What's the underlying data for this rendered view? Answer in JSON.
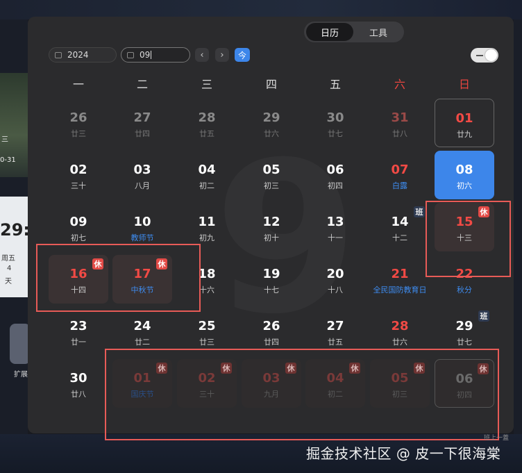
{
  "desktop": {
    "widget1": {
      "weekday_frag": "三",
      "range_frag": "0-31"
    },
    "widget2": {
      "time_frag": "29:",
      "weekday": "周五",
      "count": "4",
      "unit": "天"
    },
    "ext_label": "扩展"
  },
  "tabs": [
    {
      "label": "日历",
      "active": true
    },
    {
      "label": "工具",
      "active": false
    }
  ],
  "year_field": {
    "value": "2024"
  },
  "month_field": {
    "value": "09"
  },
  "nav": {
    "prev": "‹",
    "next": "›",
    "today": "今"
  },
  "toggle_on": true,
  "background_month": "9",
  "weekdays": [
    "一",
    "二",
    "三",
    "四",
    "五",
    "六",
    "日"
  ],
  "weekend_color": "#e9453f",
  "accent_color": "#3d86ea",
  "days": [
    {
      "day": "26",
      "lunar": "廿三",
      "style": "dim"
    },
    {
      "day": "27",
      "lunar": "廿四",
      "style": "dim"
    },
    {
      "day": "28",
      "lunar": "廿五",
      "style": "dim"
    },
    {
      "day": "29",
      "lunar": "廿六",
      "style": "dim"
    },
    {
      "day": "30",
      "lunar": "廿七",
      "style": "dim"
    },
    {
      "day": "31",
      "lunar": "廿八",
      "style": "dimred"
    },
    {
      "day": "01",
      "lunar": "廿九",
      "style": "red today-box"
    },
    {
      "day": "02",
      "lunar": "三十",
      "style": ""
    },
    {
      "day": "03",
      "lunar": "八月",
      "style": ""
    },
    {
      "day": "04",
      "lunar": "初二",
      "style": ""
    },
    {
      "day": "05",
      "lunar": "初三",
      "style": ""
    },
    {
      "day": "06",
      "lunar": "初四",
      "style": ""
    },
    {
      "day": "07",
      "lunar": "白露",
      "style": "red",
      "fest": true
    },
    {
      "day": "08",
      "lunar": "初六",
      "style": "selected"
    },
    {
      "day": "09",
      "lunar": "初七",
      "style": ""
    },
    {
      "day": "10",
      "lunar": "教师节",
      "style": "",
      "fest": true
    },
    {
      "day": "11",
      "lunar": "初九",
      "style": ""
    },
    {
      "day": "12",
      "lunar": "初十",
      "style": ""
    },
    {
      "day": "13",
      "lunar": "十一",
      "style": ""
    },
    {
      "day": "14",
      "lunar": "十二",
      "style": "",
      "badge": "班",
      "badgeType": "work"
    },
    {
      "day": "15",
      "lunar": "十三",
      "style": "holiday",
      "badge": "休",
      "badgeType": "rest"
    },
    {
      "day": "16",
      "lunar": "十四",
      "style": "holiday",
      "badge": "休",
      "badgeType": "rest"
    },
    {
      "day": "17",
      "lunar": "中秋节",
      "style": "holiday",
      "fest": true,
      "badge": "休",
      "badgeType": "rest"
    },
    {
      "day": "18",
      "lunar": "十六",
      "style": ""
    },
    {
      "day": "19",
      "lunar": "十七",
      "style": ""
    },
    {
      "day": "20",
      "lunar": "十八",
      "style": ""
    },
    {
      "day": "21",
      "lunar": "全民国防教育日",
      "style": "red",
      "fest": true
    },
    {
      "day": "22",
      "lunar": "秋分",
      "style": "red",
      "fest": true
    },
    {
      "day": "23",
      "lunar": "廿一",
      "style": ""
    },
    {
      "day": "24",
      "lunar": "廿二",
      "style": ""
    },
    {
      "day": "25",
      "lunar": "廿三",
      "style": ""
    },
    {
      "day": "26",
      "lunar": "廿四",
      "style": ""
    },
    {
      "day": "27",
      "lunar": "廿五",
      "style": ""
    },
    {
      "day": "28",
      "lunar": "廿六",
      "style": "red"
    },
    {
      "day": "29",
      "lunar": "廿七",
      "style": "",
      "badge": "班",
      "badgeType": "work"
    },
    {
      "day": "30",
      "lunar": "廿八",
      "style": ""
    },
    {
      "day": "01",
      "lunar": "国庆节",
      "style": "holiday-dim",
      "fest": true,
      "badge": "休",
      "badgeType": "rest dim"
    },
    {
      "day": "02",
      "lunar": "三十",
      "style": "holiday-dim",
      "badge": "休",
      "badgeType": "rest dim"
    },
    {
      "day": "03",
      "lunar": "九月",
      "style": "holiday-dim",
      "badge": "休",
      "badgeType": "rest dim"
    },
    {
      "day": "04",
      "lunar": "初二",
      "style": "holiday-dim",
      "badge": "休",
      "badgeType": "rest dim"
    },
    {
      "day": "05",
      "lunar": "初三",
      "style": "holiday-dim",
      "badge": "休",
      "badgeType": "rest dim"
    },
    {
      "day": "06",
      "lunar": "初四",
      "style": "holiday-dim holiday-dim-box",
      "badge": "休",
      "badgeType": "rest dim"
    }
  ],
  "footer_tiny": "班上一蓋",
  "watermark": "掘金技术社区 @ 皮一下很海棠"
}
